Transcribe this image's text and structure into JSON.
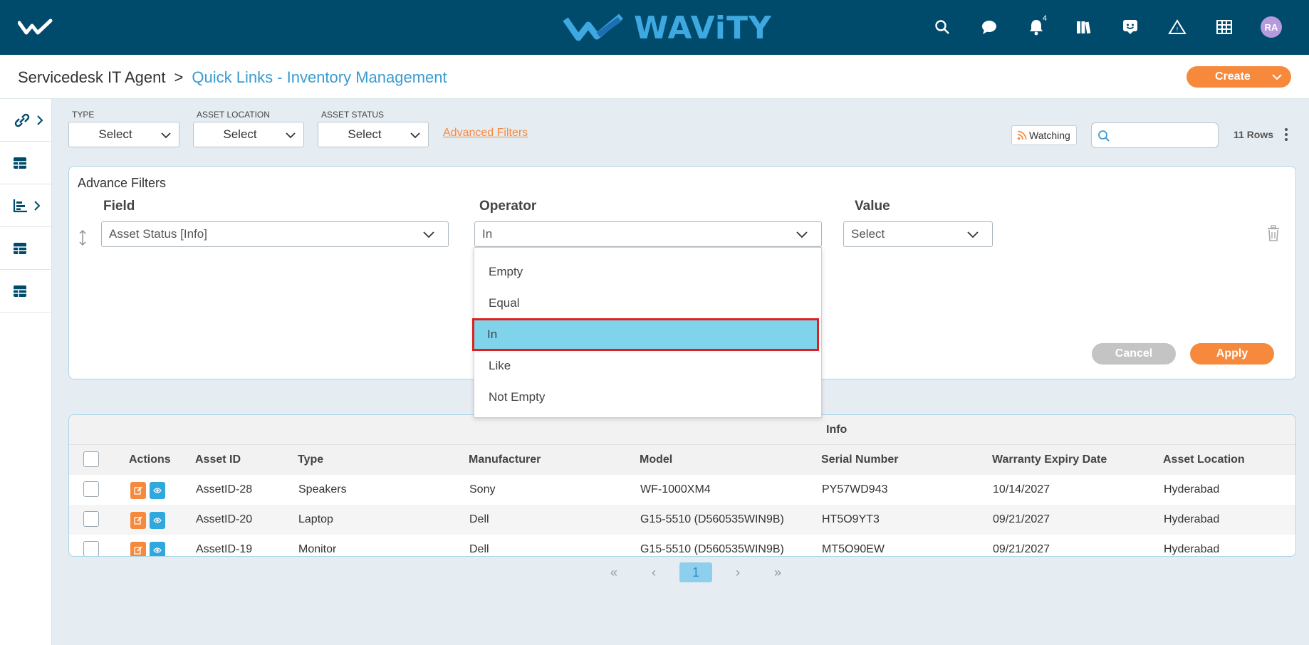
{
  "app": {
    "brand": "WAViTY",
    "notification_count": "4",
    "avatar_initials": "RA",
    "top_icons": [
      "search-icon",
      "chat-icon",
      "bell-icon",
      "library-icon",
      "feedback-icon",
      "alert-icon",
      "grid-icon"
    ]
  },
  "breadcrumb": {
    "root": "Servicedesk IT Agent",
    "separator": ">",
    "current": "Quick Links - Inventory Management"
  },
  "create_button": "Create",
  "filters": {
    "type": {
      "label": "TYPE",
      "value": "Select"
    },
    "location": {
      "label": "ASSET LOCATION",
      "value": "Select"
    },
    "status": {
      "label": "ASSET STATUS",
      "value": "Select"
    },
    "advanced_link": "Advanced Filters",
    "watching": "Watching",
    "search_placeholder": "",
    "rows_count": "11 Rows"
  },
  "advance_filters": {
    "title": "Advance Filters",
    "field_header": "Field",
    "operator_header": "Operator",
    "value_header": "Value",
    "field_value": "Asset Status [Info]",
    "operator_value": "In",
    "value_value": "Select",
    "cancel": "Cancel",
    "apply": "Apply",
    "operator_options": [
      "Empty",
      "Equal",
      "In",
      "Like",
      "Not Empty"
    ],
    "selected_option": "In"
  },
  "table": {
    "group_header": "Info",
    "columns": [
      "Actions",
      "Asset ID",
      "Type",
      "Manufacturer",
      "Model",
      "Serial Number",
      "Warranty Expiry Date",
      "Asset Location"
    ],
    "rows": [
      [
        "AssetID-28",
        "Speakers",
        "Sony",
        "WF-1000XM4",
        "PY57WD943",
        "10/14/2027",
        "Hyderabad"
      ],
      [
        "AssetID-20",
        "Laptop",
        "Dell",
        "G15-5510 (D560535WIN9B)",
        "HT5O9YT3",
        "09/21/2027",
        "Hyderabad"
      ],
      [
        "AssetID-19",
        "Monitor",
        "Dell",
        "G15-5510 (D560535WIN9B)",
        "MT5O90EW",
        "09/21/2027",
        "Hyderabad"
      ]
    ]
  },
  "pagination": {
    "first": "«",
    "prev": "‹",
    "current": "1",
    "next": "›",
    "last": "»"
  },
  "colors": {
    "topbar": "#004a6b",
    "accent": "#f7893d",
    "link": "#3a9bd1",
    "selected_option": "#7fd3ea",
    "highlight_border": "#e0201f"
  }
}
